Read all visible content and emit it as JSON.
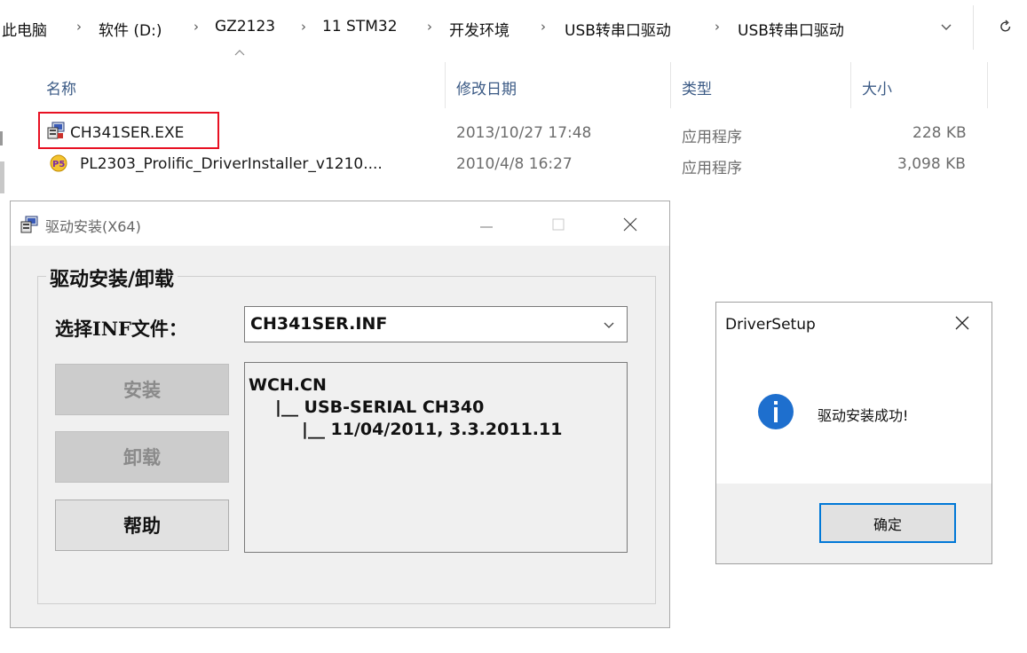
{
  "explorer": {
    "breadcrumb": [
      "此电脑",
      "软件 (D:)",
      "GZ2123",
      "11 STM32",
      "开发环境",
      "USB转串口驱动",
      "USB转串口驱动"
    ],
    "columns": {
      "name": "名称",
      "date": "修改日期",
      "type": "类型",
      "size": "大小"
    },
    "files": [
      {
        "name": "CH341SER.EXE",
        "date": "2013/10/27 17:48",
        "type": "应用程序",
        "size": "228 KB",
        "icon": "setup-icon",
        "highlighted": true
      },
      {
        "name": "PL2303_Prolific_DriverInstaller_v1210....",
        "date": "2010/4/8 16:27",
        "type": "应用程序",
        "size": "3,098 KB",
        "icon": "prolific-installer-icon",
        "highlighted": false
      }
    ],
    "highlight_color": "#e81123"
  },
  "installer": {
    "title": "驱动安装(X64)",
    "group_title": "驱动安装/卸载",
    "select_label": "选择INF文件：",
    "selected_inf": "CH341SER.INF",
    "info_lines": [
      "WCH.CN",
      "|__ USB-SERIAL CH340",
      "|__ 11/04/2011, 3.3.2011.11"
    ],
    "buttons": {
      "install": "安装",
      "uninstall": "卸载",
      "help": "帮助"
    }
  },
  "dialog": {
    "title": "DriverSetup",
    "message": "驱动安装成功!",
    "ok": "确定",
    "info_icon_color": "#1e6fce",
    "focus_color": "#0078d7"
  }
}
